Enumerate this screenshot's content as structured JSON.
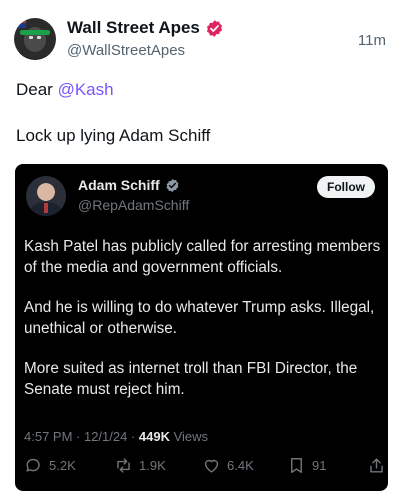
{
  "tweet": {
    "author": {
      "display_name": "Wall Street Apes",
      "handle": "@WallStreetApes"
    },
    "timestamp": "11m",
    "line1_prefix": "Dear ",
    "line1_mention": "@Kash",
    "line2": "Lock up lying Adam Schiff"
  },
  "quoted": {
    "author": {
      "display_name": "Adam Schiff",
      "handle": "@RepAdamSchiff"
    },
    "follow_label": "Follow",
    "paragraphs": [
      "Kash Patel has publicly called for arresting members of the media and government officials.",
      "And he is willing to do whatever Trump asks. Illegal, unethical or otherwise.",
      "More suited as internet troll than FBI Director, the Senate must reject him."
    ],
    "meta": {
      "time_date": "4:57 PM · 12/1/24 · ",
      "views_count": "449K",
      "views_label": " Views"
    },
    "actions": {
      "replies": "5.2K",
      "retweets": "1.9K",
      "likes": "6.4K",
      "bookmarks": "91"
    }
  },
  "colors": {
    "mention": "#7856ff",
    "verified_author": "#e0245e",
    "verified_quoted": "#8b98a5",
    "card_bg": "#000000"
  }
}
